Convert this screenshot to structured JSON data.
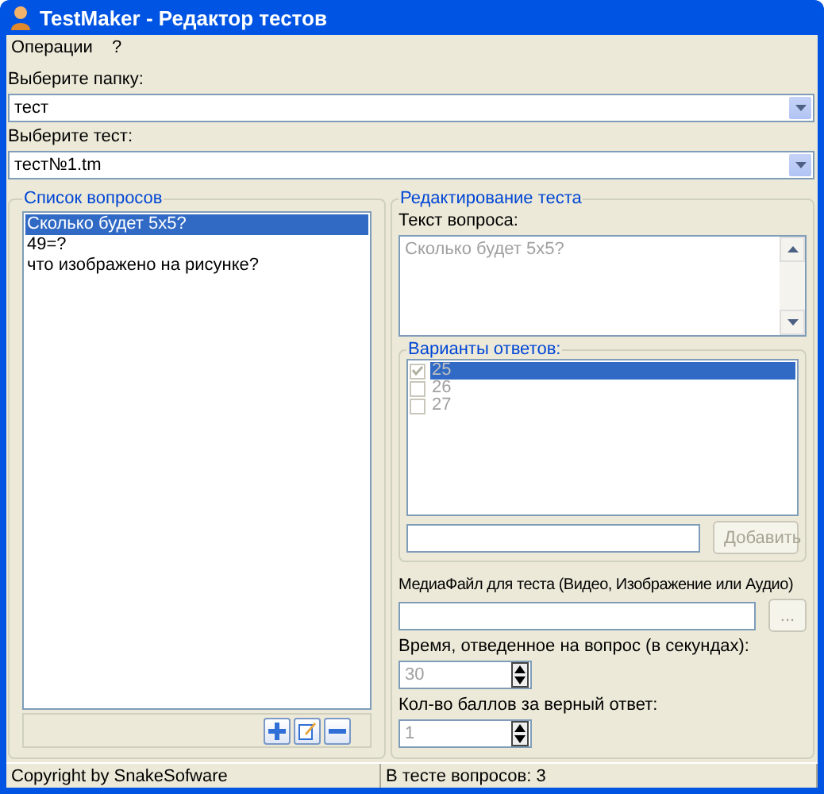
{
  "window": {
    "title": "TestMaker - Редактор тестов"
  },
  "menu": [
    "Операции",
    "?"
  ],
  "folder": {
    "label": "Выберите папку:",
    "value": "тест"
  },
  "test": {
    "label": "Выберите тест:",
    "value": "тест№1.tm"
  },
  "questions": {
    "title": "Список вопросов",
    "items": [
      {
        "text": "Сколько будет 5х5?",
        "selected": true
      },
      {
        "text": "49=?",
        "selected": false
      },
      {
        "text": "что изображено на рисунке?",
        "selected": false
      }
    ]
  },
  "editor": {
    "title": "Редактирование теста",
    "question_label": "Текст вопроса:",
    "question_text": "Сколько будет 5х5?",
    "answers": {
      "title": "Варианты ответов:",
      "items": [
        {
          "text": "25",
          "checked": true,
          "selected": true
        },
        {
          "text": "26",
          "checked": false,
          "selected": false
        },
        {
          "text": "27",
          "checked": false,
          "selected": false
        }
      ],
      "add_button": "Добавить"
    },
    "media_label": "МедиаФайл для теста (Видео, Изображение или Аудио)",
    "browse_button": "...",
    "time_label": "Время, отведенное на вопрос (в секундах):",
    "time_value": "30",
    "points_label": "Кол-во баллов за верный ответ:",
    "points_value": "1"
  },
  "status_bar": [
    "Copyright by SnakeSofware",
    "В тесте вопросов: 3"
  ]
}
